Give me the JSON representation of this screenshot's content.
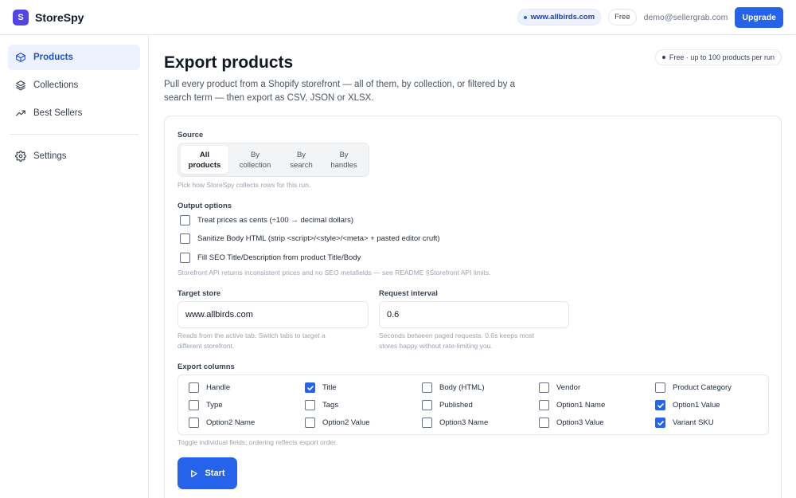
{
  "app": {
    "logo_letter": "S",
    "name": "StoreSpy",
    "accent": "#2563eb"
  },
  "header": {
    "store": "www.allbirds.com",
    "plan": "Free",
    "email": "demo@sellergrab.com",
    "upgrade_label": "Upgrade"
  },
  "sidebar": {
    "items": [
      {
        "label": "Products",
        "icon": "box-icon",
        "active": true
      },
      {
        "label": "Collections",
        "icon": "layers-icon",
        "active": false
      },
      {
        "label": "Best Sellers",
        "icon": "trending-up-icon",
        "active": false
      }
    ],
    "settings_label": "Settings"
  },
  "page": {
    "title": "Export products",
    "description": "Pull every product from a Shopify storefront — all of them, by collection, or filtered by a search term — then export as CSV, JSON or XLSX.",
    "plan_badge": "Free · up to 100 products per run"
  },
  "source": {
    "label": "Source",
    "options": [
      {
        "line1": "All",
        "line2": "products",
        "active": true
      },
      {
        "line1": "By",
        "line2": "collection",
        "active": false
      },
      {
        "line1": "By",
        "line2": "search",
        "active": false
      },
      {
        "line1": "By",
        "line2": "handles",
        "active": false
      }
    ],
    "hint": "Pick how StoreSpy collects rows for this run."
  },
  "output": {
    "label": "Output options",
    "options": [
      {
        "label": "Treat prices as cents (÷100 → decimal dollars)",
        "checked": false
      },
      {
        "label": "Sanitize Body HTML (strip <script>/<style>/<meta> + pasted editor cruft)",
        "checked": false
      },
      {
        "label": "Fill SEO Title/Description from product Title/Body",
        "checked": false
      }
    ],
    "hint": "Storefront API returns inconsistent prices and no SEO metafields — see README §Storefront API limits."
  },
  "target_store": {
    "label": "Target store",
    "value": "www.allbirds.com",
    "hint_line1": "Reads from the active tab. Switch tabs to target a",
    "hint_line2": "different storefront."
  },
  "request_interval": {
    "label": "Request interval",
    "value": "0.6",
    "hint_line1": "Seconds between paged requests. 0.6s keeps most",
    "hint_line2": "stores happy without rate-limiting you."
  },
  "columns": {
    "label": "Export columns",
    "items": [
      {
        "label": "Handle",
        "checked": false
      },
      {
        "label": "Title",
        "checked": true
      },
      {
        "label": "Body (HTML)",
        "checked": false
      },
      {
        "label": "Vendor",
        "checked": false
      },
      {
        "label": "Product Category",
        "checked": false
      },
      {
        "label": "Type",
        "checked": false
      },
      {
        "label": "Tags",
        "checked": false
      },
      {
        "label": "Published",
        "checked": false
      },
      {
        "label": "Option1 Name",
        "checked": false
      },
      {
        "label": "Option1 Value",
        "checked": true
      },
      {
        "label": "Option2 Name",
        "checked": false
      },
      {
        "label": "Option2 Value",
        "checked": false
      },
      {
        "label": "Option3 Name",
        "checked": false
      },
      {
        "label": "Option3 Value",
        "checked": false
      },
      {
        "label": "Variant SKU",
        "checked": true
      }
    ],
    "hint": "Toggle individual fields; ordering reflects export order."
  },
  "start_label": "Start"
}
